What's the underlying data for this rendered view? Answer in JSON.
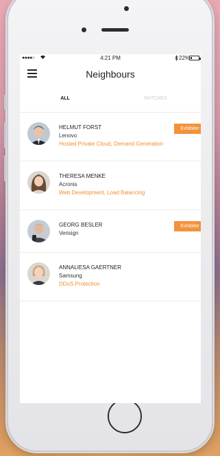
{
  "status_bar": {
    "signal": "●●●●○",
    "time": "4:21 PM",
    "battery": "22%",
    "battery_level": 0.22
  },
  "nav": {
    "title": "Neighbours"
  },
  "tabs": [
    {
      "label": "ALL",
      "active": true
    },
    {
      "label": "MATCHES",
      "active": false
    }
  ],
  "people": [
    {
      "name": "HELMUT FORST",
      "company": "Lenovo",
      "tags": "Hosted Private Cloud, Demand Generation",
      "badge": "Exhibitor"
    },
    {
      "name": "THERESA MENKE",
      "company": "Acronis",
      "tags": "Web Development, Load Balancing",
      "badge": ""
    },
    {
      "name": "GEORG BESLER",
      "company": "Verisign",
      "tags": "",
      "badge": "Exhibitor"
    },
    {
      "name": "ANNALIESA GAERTNER",
      "company": "Samsung",
      "tags": "DDoS Protection",
      "badge": ""
    }
  ],
  "colors": {
    "accent": "#f3923a",
    "tag_text": "#f28d2c"
  }
}
